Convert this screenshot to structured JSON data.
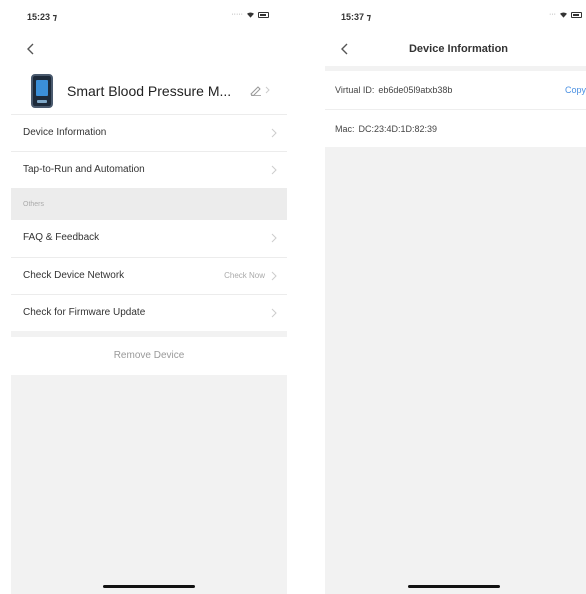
{
  "left_screen": {
    "status": {
      "time": "15:23 ⁊"
    },
    "device": {
      "name": "Smart Blood Pressure M..."
    },
    "menu_top": [
      {
        "label": "Device Information"
      },
      {
        "label": "Tap-to-Run and Automation"
      }
    ],
    "section_title": "Others",
    "menu_others": [
      {
        "label": "FAQ & Feedback",
        "value": ""
      },
      {
        "label": "Check Device Network",
        "value": "Check Now"
      },
      {
        "label": "Check for Firmware Update",
        "value": ""
      }
    ],
    "remove_label": "Remove Device"
  },
  "right_screen": {
    "status": {
      "time": "15:37 ⁊"
    },
    "title": "Device Information",
    "virtual_id": {
      "label": "Virtual ID:",
      "value": "eb6de05l9atxb38b",
      "action": "Copy"
    },
    "mac": {
      "label": "Mac:",
      "value": "DC:23:4D:1D:82:39"
    }
  },
  "colors": {
    "background": "#f2f2f2",
    "panel": "#ffffff",
    "link": "#4a90e2",
    "muted": "#aaaaaa"
  }
}
